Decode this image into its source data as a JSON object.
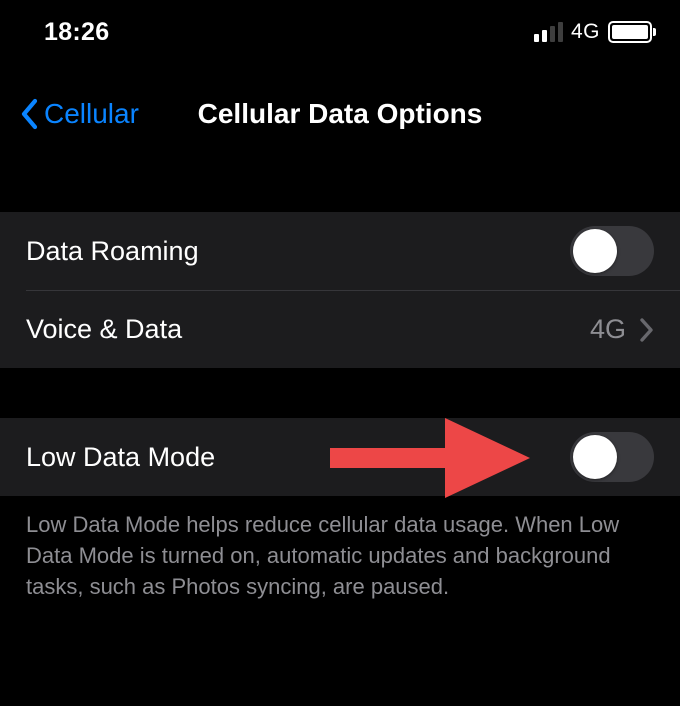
{
  "status": {
    "time": "18:26",
    "network_type": "4G"
  },
  "nav": {
    "back_label": "Cellular",
    "title": "Cellular Data Options"
  },
  "rows": {
    "data_roaming": {
      "label": "Data Roaming"
    },
    "voice_data": {
      "label": "Voice & Data",
      "value": "4G"
    },
    "low_data_mode": {
      "label": "Low Data Mode"
    }
  },
  "footer": {
    "low_data_mode": "Low Data Mode helps reduce cellular data usage. When Low Data Mode is turned on, automatic updates and background tasks, such as Photos syncing, are paused."
  },
  "colors": {
    "accent": "#0a84ff",
    "annotation": "#ed4747"
  }
}
